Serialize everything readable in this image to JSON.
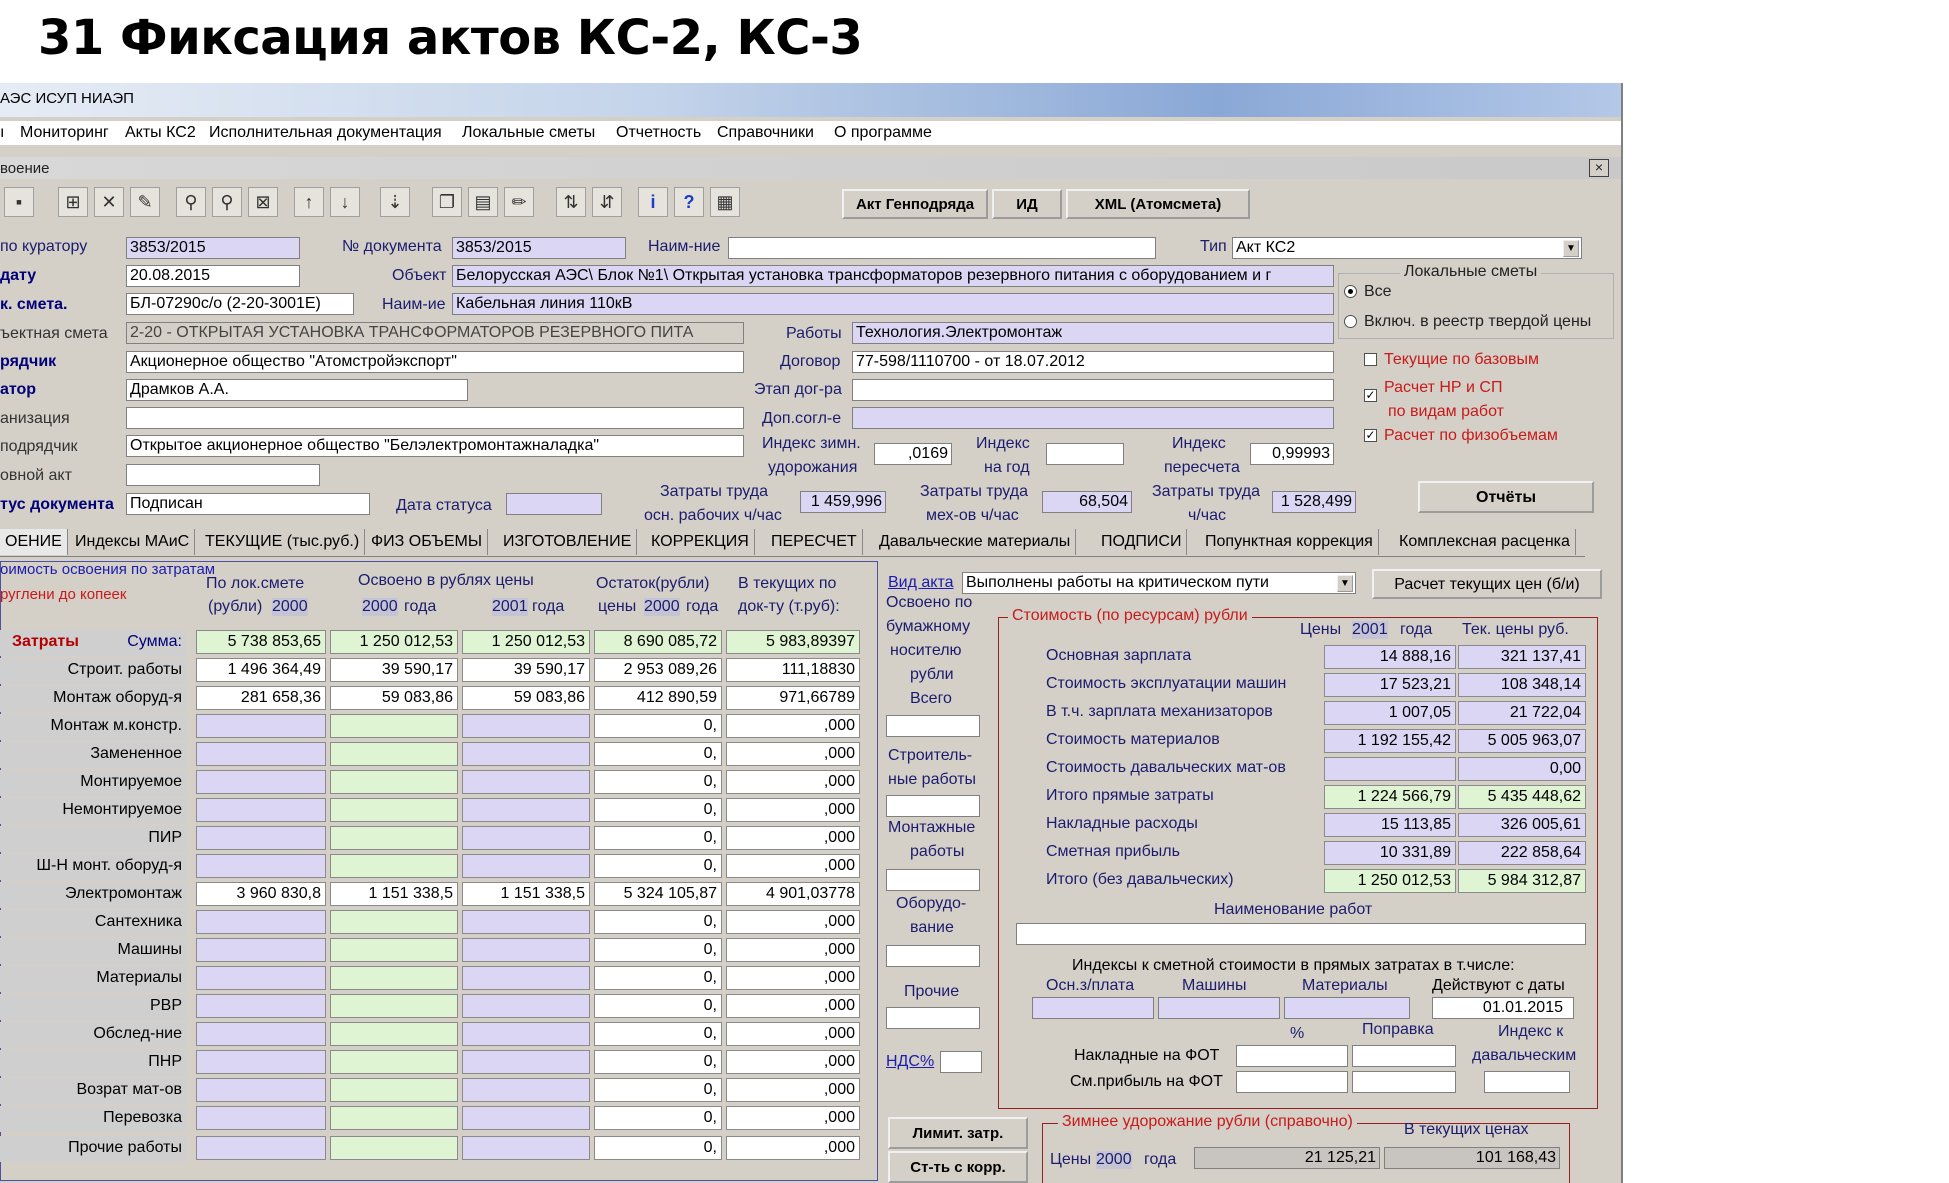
{
  "slide_title": "31 Фиксация актов КС-2, КС-3",
  "window_title": "АЭС ИСУП  НИАЭП",
  "menu": [
    "Мониторинг",
    "Акты КС2",
    "Исполнительная документация",
    "Локальные сметы",
    "Отчетность",
    "Справочники",
    "О программе"
  ],
  "child_title": "воение",
  "close_glyph": "×",
  "toolbar_buttons": {
    "gp": "Акт Генподряда",
    "id": "ИД",
    "xml": "XML (Атомсмета)"
  },
  "header": {
    "curator_label": "по куратору",
    "curator": "3853/2015",
    "docnum_label": "№ документа",
    "docnum": "3853/2015",
    "name_label": "Наим-ние",
    "name": "",
    "type_label": "Тип",
    "type": "Акт КС2",
    "date_label": "дату",
    "date": "20.08.2015",
    "object_label": "Объект",
    "object": "Белорусская АЭС\\ Блок №1\\ Открытая установка трансформаторов резервного питания с оборудованием и г",
    "lsmeta_label": "к. смета.",
    "lsmeta": "БЛ-07290с/о (2-20-3001Е)",
    "naim2_label": "Наим-ие",
    "naim2": "Кабельная линия 110кВ",
    "objsmeta_label": "ъектная смета",
    "objsmeta": "2-20 - ОТКРЫТАЯ УСТАНОВКА ТРАНСФОРМАТОРОВ РЕЗЕРВНОГО ПИТА",
    "works_label": "Работы",
    "works": "Технология.Электромонтаж",
    "contractor_label": "рядчик",
    "contractor": "Акционерное общество \"Атомстройэкспорт\"",
    "contract_label": "Договор",
    "contract": "77-598/1110700 -  от 18.07.2012",
    "curator2_label": "атор",
    "curator2": "Драмков А.А.",
    "stage_label": "Этап дог-ра",
    "stage": "",
    "org_label": "анизация",
    "org": "",
    "dopsogl_label": "Доп.согл-е",
    "dopsogl": "",
    "subcontr_label": "подрядчик",
    "subcontr": "Открытое акционерное общество \"Белэлектромонтажналадка\"",
    "idx_winter_label1": "Индекс зимн.",
    "idx_winter_label2": "удорожания",
    "idx_winter": ",0169",
    "idx_year_label1": "Индекс",
    "idx_year_label2": "на год",
    "idx_year": "",
    "idx_recalc_label1": "Индекс",
    "idx_recalc_label2": "пересчета",
    "idx_recalc": "0,99993",
    "basic_act_label": "овной акт",
    "basic_act": "",
    "status_label": "тус документа",
    "status": "Подписан",
    "status_date_label": "Дата статуса",
    "status_date": "",
    "labor_workers_label1": "Затраты труда",
    "labor_workers_label2": "осн. рабочих ч/час",
    "labor_workers": "1 459,996",
    "labor_mech_label1": "Затраты труда",
    "labor_mech_label2": "мех-ов ч/час",
    "labor_mech": "68,504",
    "labor_total_label1": "Затраты труда",
    "labor_total_label2": "ч/час",
    "labor_total": "1 528,499",
    "reports_btn": "Отчёты"
  },
  "local_estimates": {
    "title": "Локальные сметы",
    "opt_all": "Все",
    "opt_reg": "Включ. в реестр твердой цены"
  },
  "checks": {
    "current_base": "Текущие по базовым",
    "nr_sp1": "Расчет НР и СП",
    "nr_sp2": "по видам работ",
    "phys": "Расчет по физобъемам"
  },
  "tabs": [
    "ОЕНИЕ",
    "Индексы МАиС",
    "ТЕКУЩИЕ (тыс.руб.)",
    "ФИЗ ОБЪЕМЫ",
    "ИЗГОТОВЛЕНИЕ",
    "КОРРЕКЦИЯ",
    "ПЕРЕСЧЕТ",
    "Давальческие материалы",
    "ПОДПИСИ",
    "Попунктная коррекция",
    "Комплексная расценка"
  ],
  "left": {
    "note1": "оимость освоения по затратам",
    "note2": "руглени до копеек",
    "col1a": "По лок.смете",
    "col1b": "(рубли)",
    "col1y": "2000",
    "col2a": "Освоено в рублях цены",
    "col2y": "2000",
    "col2g": "года",
    "col3y": "2001",
    "col3g": "года",
    "col4a": "Остаток(рубли)",
    "col4b": "цены",
    "col4y": "2000",
    "col4g": "года",
    "col5a": "В текущих по",
    "col5b": "док-ту (т.руб):",
    "zatraty": "Затраты",
    "summa": "Сумма:",
    "rows": [
      {
        "label": "Сумма:",
        "v": [
          "5 738 853,65",
          "1 250 012,53",
          "1 250 012,53",
          "8 690 085,72",
          "5 983,89397"
        ]
      },
      {
        "label": "Строит. работы",
        "v": [
          "1 496 364,49",
          "39 590,17",
          "39 590,17",
          "2 953 089,26",
          "111,18830"
        ]
      },
      {
        "label": "Монтаж оборуд-я",
        "v": [
          "281 658,36",
          "59 083,86",
          "59 083,86",
          "412 890,59",
          "971,66789"
        ]
      },
      {
        "label": "Монтаж м.констр.",
        "v": [
          "",
          "",
          "",
          "0,",
          ",000"
        ]
      },
      {
        "label": "Замененное",
        "v": [
          "",
          "",
          "",
          "0,",
          ",000"
        ]
      },
      {
        "label": "Монтируемое",
        "v": [
          "",
          "",
          "",
          "0,",
          ",000"
        ]
      },
      {
        "label": "Немонтируемое",
        "v": [
          "",
          "",
          "",
          "0,",
          ",000"
        ]
      },
      {
        "label": "ПИР",
        "v": [
          "",
          "",
          "",
          "0,",
          ",000"
        ]
      },
      {
        "label": "Ш-Н монт. оборуд-я",
        "v": [
          "",
          "",
          "",
          "0,",
          ",000"
        ]
      },
      {
        "label": "Электромонтаж",
        "v": [
          "3 960 830,8",
          "1 151 338,5",
          "1 151 338,5",
          "5 324 105,87",
          "4 901,03778"
        ]
      },
      {
        "label": "Сантехника",
        "v": [
          "",
          "",
          "",
          "0,",
          ",000"
        ]
      },
      {
        "label": "Машины",
        "v": [
          "",
          "",
          "",
          "0,",
          ",000"
        ]
      },
      {
        "label": "Материалы",
        "v": [
          "",
          "",
          "",
          "0,",
          ",000"
        ]
      },
      {
        "label": "РВР",
        "v": [
          "",
          "",
          "",
          "0,",
          ",000"
        ]
      },
      {
        "label": "Обслед-ние",
        "v": [
          "",
          "",
          "",
          "0,",
          ",000"
        ]
      },
      {
        "label": "ПНР",
        "v": [
          "",
          "",
          "",
          "0,",
          ",000"
        ]
      },
      {
        "label": "Возрат мат-ов",
        "v": [
          "",
          "",
          "",
          "0,",
          ",000"
        ]
      },
      {
        "label": "Перевозка",
        "v": [
          "",
          "",
          "",
          "0,",
          ",000"
        ]
      },
      {
        "label": "Прочие работы",
        "v": [
          "",
          "",
          "",
          "0,",
          ",000"
        ]
      }
    ]
  },
  "middle": {
    "vid_akta": "Вид акта",
    "vid_akta_val": "Выполнены работы на критическом пути",
    "recalc_btn": "Расчет текущих цен (б/и)",
    "paper1": "Освоено по",
    "paper2": "бумажному",
    "paper3": "носителю",
    "paper4": "рубли",
    "paper5": "Всего",
    "str1": "Строитель-",
    "str2": "ные работы",
    "mont1": "Монтажные",
    "mont2": "работы",
    "obor1": "Оборудо-",
    "obor2": "вание",
    "other": "Прочие",
    "nds": "НДС%",
    "limit_btn": "Лимит. затр.",
    "corr_btn": "Ст-ть с корр."
  },
  "right": {
    "title": "Стоимость (по ресурсам) рубли",
    "prices": "Цены",
    "year": "2001",
    "god": "года",
    "cur": "Тек. цены руб.",
    "rows": [
      {
        "label": "Основная зарплата",
        "a": "14 888,16",
        "b": "321 137,41",
        "ca": "cv",
        "cb": "cv"
      },
      {
        "label": "Стоимость эксплуатации машин",
        "a": "17 523,21",
        "b": "108 348,14",
        "ca": "cv",
        "cb": "cv"
      },
      {
        "label": "В т.ч. зарплата механизаторов",
        "a": "1 007,05",
        "b": "21 722,04",
        "ca": "cv",
        "cb": "cv"
      },
      {
        "label": "Стоимость материалов",
        "a": "1 192 155,42",
        "b": "5 005 963,07",
        "ca": "cv",
        "cb": "cv"
      },
      {
        "label": "Стоимость давальческих мат-ов",
        "a": "",
        "b": "0,00",
        "ca": "cv",
        "cb": "cv"
      },
      {
        "label": "Итого прямые затраты",
        "a": "1 224 566,79",
        "b": "5 435 448,62",
        "ca": "cg",
        "cb": "cg"
      },
      {
        "label": "Накладные расходы",
        "a": "15 113,85",
        "b": "326 005,61",
        "ca": "cv",
        "cb": "cv"
      },
      {
        "label": "Сметная прибыль",
        "a": "10 331,89",
        "b": "222 858,64",
        "ca": "cv",
        "cb": "cv"
      },
      {
        "label": "Итого (без давальческих)",
        "a": "1 250 012,53",
        "b": "5 984 312,87",
        "ca": "cg",
        "cb": "cg"
      }
    ],
    "works_name": "Наименование работ",
    "indices_title": "Индексы  к сметной стоимости в прямых затратах в т.числе:",
    "osn": "Осн.з/плата",
    "mash": "Машины",
    "mat": "Материалы",
    "since": "Действуют с даты",
    "since_val": "01.01.2015",
    "pct": "%",
    "popr": "Поправка",
    "idx_dav1": "Индекс к",
    "idx_dav2": "давальческим",
    "nakl": "Накладные на ФОТ",
    "smpr": "См.прибыль на ФОТ",
    "winter_title": "Зимнее удорожание рубли (справочно)",
    "winter_cur": "В текущих ценах",
    "winter_prices": "Цены",
    "winter_year": "2000",
    "winter_god": "года",
    "winter_val": "21 125,21",
    "winter_cur_val": "101 168,43"
  }
}
